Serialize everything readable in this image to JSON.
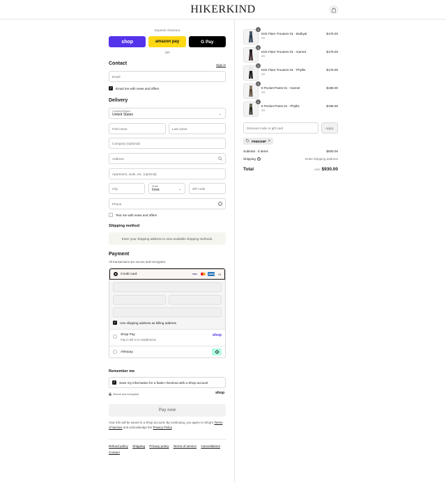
{
  "header": {
    "logo": "HIKERKIND"
  },
  "express": {
    "label": "Express checkout",
    "shop": "shop",
    "amazon": "amazon pay",
    "gpay": "G Pay",
    "or": "OR"
  },
  "contact": {
    "title": "Contact",
    "sign_in": "Sign in",
    "email_placeholder": "Email",
    "email_news": "Email me with news and offers"
  },
  "delivery": {
    "title": "Delivery",
    "country_label": "Country/Region",
    "country_value": "United States",
    "first_name": "First name",
    "last_name": "Last name",
    "company": "Company (optional)",
    "address": "Address",
    "apartment": "Apartment, suite, etc. (optional)",
    "city": "City",
    "state_label": "State",
    "state_value": "Iowa",
    "zip": "ZIP code",
    "phone": "Phone",
    "text_news": "Text me with news and offers"
  },
  "shipping": {
    "title": "Shipping method",
    "notice": "Enter your shipping address to view available shipping methods."
  },
  "payment": {
    "title": "Payment",
    "subtitle": "All transactions are secure and encrypted.",
    "credit_card": "Credit card",
    "more_cards": "+5",
    "billing_same": "Use shipping address as billing address",
    "shop_pay": "Shop Pay",
    "shop_pay_sub": "Pay in full or in installments",
    "shop_logo": "shop",
    "afterpay": "Afterpay",
    "card_visa": "VISA",
    "card_amex": "AMEX"
  },
  "remember": {
    "title": "Remember me",
    "save_info": "Save my information for a faster checkout with a Shop account",
    "secure": "Secure and encrypted",
    "shop_logo": "shop"
  },
  "pay_now": "Pay now",
  "legal": {
    "text_a": "Your info will be saved to a Shop account. By continuing, you agree to Shop's",
    "tos": "Terms of Service",
    "text_b": "and acknowledge the",
    "privacy": "Privacy Policy",
    "end": "."
  },
  "footer": {
    "links": [
      "Refund policy",
      "Shipping",
      "Privacy policy",
      "Terms of service",
      "Cancellations",
      "Contact"
    ]
  },
  "cart": {
    "items": [
      {
        "name": "Kick Flare Trousers 01 - Bathyal",
        "size": "XS",
        "qty": "1",
        "price": "$178.00"
      },
      {
        "name": "Kick Flare Trousers 01 - Garnet",
        "size": "XS",
        "qty": "1",
        "price": "$178.00"
      },
      {
        "name": "Kick Flare Trousers 01 - Phyllis",
        "size": "XS",
        "qty": "1",
        "price": "$178.00"
      },
      {
        "name": "8 Pocket Pants 01 - Garnet",
        "size": "XS",
        "qty": "1",
        "price": "$198.00"
      },
      {
        "name": "8 Pocket Pants 01 - Phyllis",
        "size": "XS",
        "qty": "1",
        "price": "$198.00"
      }
    ],
    "discount_placeholder": "Discount code or gift card",
    "apply": "Apply",
    "code": "FREESHIP",
    "subtotal_label": "Subtotal · 5 items",
    "subtotal": "$930.00",
    "shipping_label": "Shipping",
    "shipping_value": "Enter shipping address",
    "total_label": "Total",
    "currency": "USD",
    "total": "$930.00"
  },
  "colors": {
    "shop_purple": "#5433eb",
    "amazon_yellow": "#ffd814",
    "afterpay_mint": "#b2fce4"
  }
}
